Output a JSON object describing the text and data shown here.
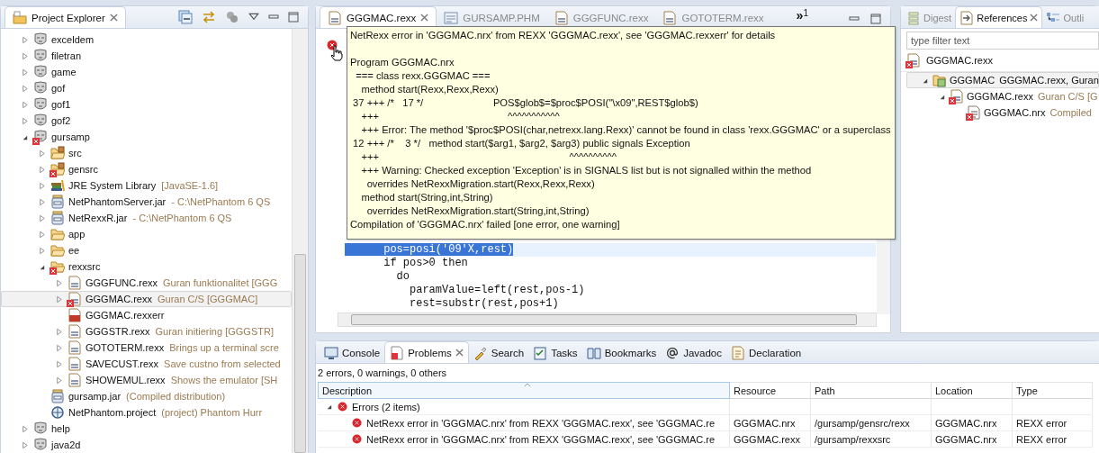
{
  "project_explorer": {
    "title": "Project Explorer",
    "items": [
      {
        "label": "exceldem",
        "kind": "project",
        "expanded": false,
        "selected": false
      },
      {
        "label": "filetran",
        "kind": "project",
        "expanded": false,
        "selected": false
      },
      {
        "label": "game",
        "kind": "project",
        "expanded": false,
        "selected": false
      },
      {
        "label": "gof",
        "kind": "project",
        "expanded": false,
        "selected": false
      },
      {
        "label": "gof1",
        "kind": "project",
        "expanded": false,
        "selected": false
      },
      {
        "label": "gof2",
        "kind": "project",
        "expanded": false,
        "selected": false
      },
      {
        "label": "gursamp",
        "kind": "project",
        "error": true,
        "expanded": true,
        "selected": false,
        "children": [
          {
            "label": "src",
            "kind": "package-folder",
            "expanded": false,
            "selected": false
          },
          {
            "label": "gensrc",
            "kind": "package-folder",
            "error": true,
            "expanded": false,
            "selected": false
          },
          {
            "label": "JRE System Library",
            "detail": "[JavaSE-1.6]",
            "kind": "library",
            "expanded": false,
            "selected": false
          },
          {
            "label": "NetPhantomServer.jar",
            "detail": "- C:\\NetPhantom 6 QS",
            "kind": "jar",
            "expanded": false,
            "selected": false
          },
          {
            "label": "NetRexxR.jar",
            "detail": "- C:\\NetPhantom 6 QS",
            "kind": "jar",
            "expanded": false,
            "selected": false
          },
          {
            "label": "app",
            "kind": "folder",
            "expanded": false,
            "selected": false
          },
          {
            "label": "ee",
            "kind": "folder",
            "expanded": false,
            "selected": false
          },
          {
            "label": "rexxsrc",
            "kind": "folder",
            "error": true,
            "expanded": true,
            "selected": false,
            "children": [
              {
                "label": "GGGFUNC.rexx",
                "detail": "Guran funktionalitet [GGG",
                "kind": "rexx",
                "expanded": false,
                "selected": false
              },
              {
                "label": "GGGMAC.rexx",
                "detail": "Guran C/S [GGGMAC]",
                "kind": "rexx",
                "error": true,
                "expanded": false,
                "selected": true
              },
              {
                "label": "GGGMAC.rexxerr",
                "kind": "errfile",
                "selected": false
              },
              {
                "label": "GGGSTR.rexx",
                "detail": "Guran initiering [GGGSTR]",
                "kind": "rexx",
                "expanded": false,
                "selected": false
              },
              {
                "label": "GOTOTERM.rexx",
                "detail": "Brings up a terminal scre",
                "kind": "rexx",
                "expanded": false,
                "selected": false
              },
              {
                "label": "SAVECUST.rexx",
                "detail": "Save custno from selected",
                "kind": "rexx",
                "expanded": false,
                "selected": false
              },
              {
                "label": "SHOWEMUL.rexx",
                "detail": "Shows the emulator [SH",
                "kind": "rexx",
                "expanded": false,
                "selected": false
              }
            ]
          },
          {
            "label": "gursamp.jar",
            "detail": "(Compiled distribution)",
            "kind": "jarfile",
            "selected": false
          },
          {
            "label": "NetPhantom.project",
            "detail": "(project)  Phantom Hurr",
            "kind": "projectfile",
            "selected": false
          }
        ]
      },
      {
        "label": "help",
        "kind": "project",
        "expanded": false,
        "selected": false
      },
      {
        "label": "java2d",
        "kind": "project",
        "expanded": false,
        "selected": false
      }
    ]
  },
  "editor": {
    "tabs": [
      {
        "label": "GGGMAC.rexx",
        "kind": "rexx",
        "selected": true
      },
      {
        "label": "GURSAMP.PHM",
        "kind": "phm",
        "selected": false
      },
      {
        "label": "GGGFUNC.rexx",
        "kind": "rexx",
        "selected": false
      },
      {
        "label": "GOTOTERM.rexx",
        "kind": "rexx",
        "selected": false
      }
    ],
    "overflow": {
      "glyph": "»",
      "count": "1"
    },
    "code": [
      {
        "text": "      pos=posi('09'X,rest)",
        "selected": true
      },
      {
        "text": "      if pos>0 then",
        "selected": false
      },
      {
        "text": "        do",
        "selected": false
      },
      {
        "text": "          paramValue=left(rest,pos-1)",
        "selected": false
      },
      {
        "text": "          rest=substr(rest,pos+1)",
        "selected": false
      }
    ],
    "tooltip": {
      "paragraphs": [
        [
          "NetRexx error in 'GGGMAC.nrx' from REXX 'GGGMAC.rexx', see 'GGGMAC.rexxerr' for details"
        ],
        [
          "Program GGGMAC.nrx",
          "  === class rexx.GGGMAC ===",
          "    method start(Rexx,Rexx,Rexx)",
          " 37 +++ /*   17 */                         POS$glob$=$proc$POSI(\"\\x09\",REST$glob$)",
          "    +++                                              ^^^^^^^^^^^",
          "    +++ Error: The method '$proc$POSI(char,netrexx.lang.Rexx)' cannot be found in class 'rexx.GGGMAC' or a superclass",
          " 12 +++ /*    3 */   method start($arg1, $arg2, $arg3) public signals Exception",
          "    +++                                                                    ^^^^^^^^^^",
          "    +++ Warning: Checked exception 'Exception' is in SIGNALS list but is not signalled within the method",
          "      overrides NetRexxMigration.start(Rexx,Rexx,Rexx)",
          "    method start(String,int,String)",
          "      overrides NetRexxMigration.start(String,int,String)",
          "Compilation of 'GGGMAC.nrx' failed [one error, one warning]"
        ]
      ]
    }
  },
  "references": {
    "tabs": [
      {
        "label": "Digest",
        "kind": "digest",
        "selected": false
      },
      {
        "label": "References",
        "kind": "references",
        "selected": true
      },
      {
        "label": "Outli",
        "kind": "outline",
        "selected": false
      }
    ],
    "filter": {
      "placeholder": "type filter text"
    },
    "input": {
      "label": "GGGMAC.rexx",
      "kind": "rexx",
      "error": true
    },
    "items": [
      {
        "label": "GGGMAC",
        "detail": "GGGMAC.rexx, Guran",
        "kind": "class",
        "expanded": true,
        "selected": true,
        "children": [
          {
            "label": "GGGMAC.rexx",
            "detail": "Guran C/S [G",
            "kind": "rexx",
            "error": true,
            "expanded": true,
            "selected": false,
            "children": [
              {
                "label": "GGGMAC.nrx",
                "detail": "Compiled",
                "kind": "nrx",
                "error": true,
                "selected": false
              }
            ]
          }
        ]
      }
    ]
  },
  "bottom": {
    "tabs": [
      {
        "label": "Console",
        "kind": "console",
        "selected": false
      },
      {
        "label": "Problems",
        "kind": "problems",
        "selected": true
      },
      {
        "label": "Search",
        "kind": "search",
        "selected": false
      },
      {
        "label": "Tasks",
        "kind": "tasks",
        "selected": false
      },
      {
        "label": "Bookmarks",
        "kind": "bookmarks",
        "selected": false
      },
      {
        "label": "Javadoc",
        "kind": "javadoc",
        "selected": false
      },
      {
        "label": "Declaration",
        "kind": "declaration",
        "selected": false
      }
    ],
    "summary": "2 errors, 0 warnings, 0 others",
    "columns": [
      {
        "label": "Description",
        "sorted": true
      },
      {
        "label": "Resource",
        "sorted": false
      },
      {
        "label": "Path",
        "sorted": false
      },
      {
        "label": "Location",
        "sorted": false
      },
      {
        "label": "Type",
        "sorted": false
      }
    ],
    "group": {
      "label": "Errors (2 items)",
      "expanded": true
    },
    "rows": [
      {
        "cells": [
          "NetRexx error in 'GGGMAC.nrx' from REXX 'GGGMAC.rexx', see 'GGGMAC.re",
          "GGGMAC.nrx",
          "/gursamp/gensrc/rexx",
          "GGGMAC.nrx",
          "REXX error"
        ]
      },
      {
        "cells": [
          "NetRexx error in 'GGGMAC.nrx' from REXX 'GGGMAC.rexx', see 'GGGMAC.re",
          "GGGMAC.rexx",
          "/gursamp/rexxsrc",
          "GGGMAC.nrx",
          "REXX error"
        ]
      }
    ]
  }
}
